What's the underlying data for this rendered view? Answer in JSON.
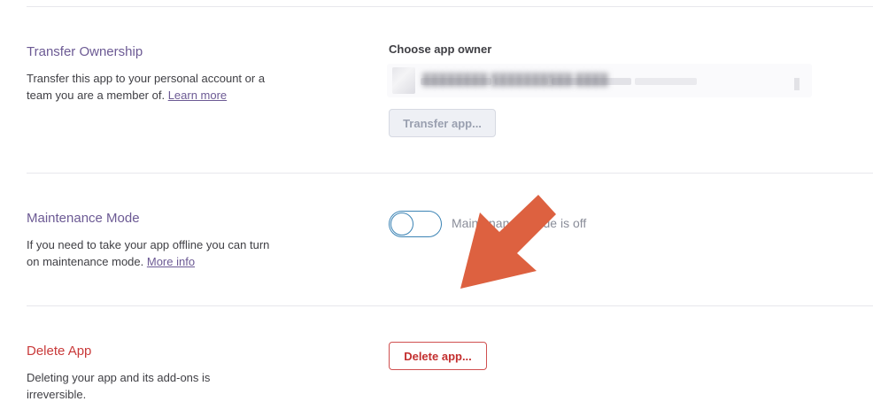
{
  "transfer": {
    "title": "Transfer Ownership",
    "description": "Transfer this app to your personal account or a team you are a member of. ",
    "link": "Learn more",
    "field_label": "Choose app owner",
    "owner_value": "████████ ██████████ ████",
    "button_label": "Transfer app..."
  },
  "maintenance": {
    "title": "Maintenance Mode",
    "description": "If you need to take your app offline you can turn on maintenance mode. ",
    "link": "More info",
    "toggle_state": "off",
    "toggle_label": "Maintenance mode is off"
  },
  "delete": {
    "title": "Delete App",
    "description": "Deleting your app and its add-ons is irreversible.",
    "button_label": "Delete app..."
  },
  "colors": {
    "title": "#6c5a94",
    "danger": "#c93a3a",
    "toggle_border": "#3c84b5",
    "arrow": "#dd6140"
  },
  "icons": {
    "annotation_arrow": "arrow-down-left-icon"
  }
}
